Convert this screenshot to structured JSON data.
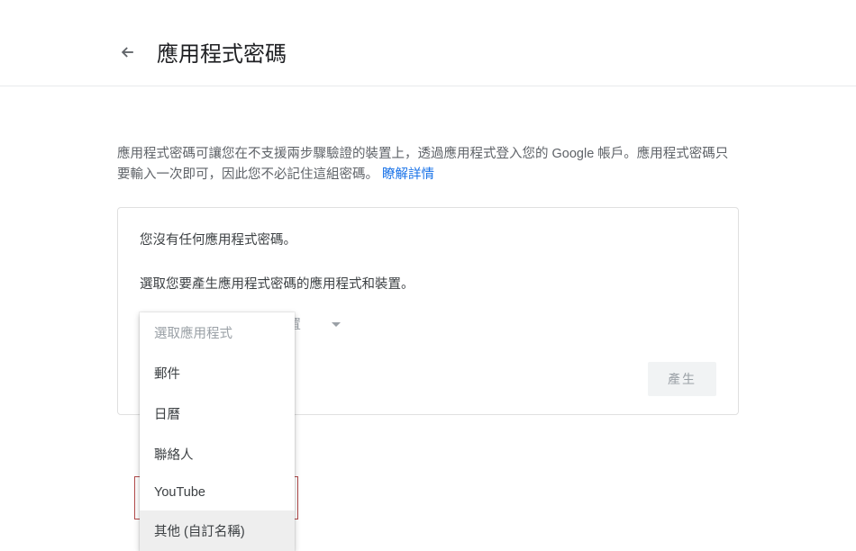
{
  "header": {
    "title": "應用程式密碼"
  },
  "description": {
    "text": "應用程式密碼可讓您在不支援兩步驟驗證的裝置上，透過應用程式登入您的 Google 帳戶。應用程式密碼只要輸入一次即可，因此您不必記住這組密碼。",
    "learn_more": "瞭解詳情"
  },
  "card": {
    "no_passwords": "您沒有任何應用程式密碼。",
    "select_prompt": "選取您要產生應用程式密碼的應用程式和裝置。",
    "select_app_label": "選取應用程式",
    "select_device_label": "選取裝置",
    "generate_label": "產生"
  },
  "dropdown": {
    "header": "選取應用程式",
    "items": [
      {
        "label": "郵件"
      },
      {
        "label": "日曆"
      },
      {
        "label": "聯絡人"
      },
      {
        "label": "YouTube"
      },
      {
        "label": "其他 (自訂名稱)",
        "highlighted": true
      }
    ]
  }
}
